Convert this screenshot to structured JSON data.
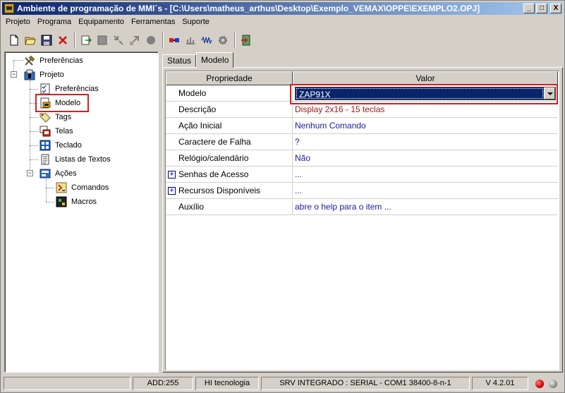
{
  "window": {
    "title": "Ambiente de programação de MMI´s - [C:\\Users\\matheus_arthus\\Desktop\\Exemplo_VEMAX\\OPPE\\EXEMPLO2.OPJ]",
    "minimize_glyph": "_",
    "maximize_glyph": "□",
    "close_glyph": "X"
  },
  "menu": [
    "Projeto",
    "Programa",
    "Equipamento",
    "Ferramentas",
    "Suporte"
  ],
  "toolbar": {
    "icons": [
      "new-file-icon",
      "open-folder-icon",
      "save-icon",
      "delete-x-icon",
      "export-icon",
      "tool2-icon",
      "tool3-icon",
      "tool4-icon",
      "record-icon",
      "connect-icon",
      "transfer-icon",
      "signal-icon",
      "settings-gear-icon",
      "exit-door-icon"
    ]
  },
  "tree": {
    "root_preferences": "Preferências",
    "project": "Projeto",
    "children": [
      "Preferências",
      "Modelo",
      "Tags",
      "Telas",
      "Teclado",
      "Listas de Textos"
    ],
    "actions": "Ações",
    "actions_children": [
      "Comandos",
      "Macros"
    ]
  },
  "tabs": [
    "Status",
    "Modelo"
  ],
  "grid": {
    "header_property": "Propriedade",
    "header_value": "Valor",
    "rows": [
      {
        "property": "Modelo",
        "value": "ZAP91X"
      },
      {
        "property": "Descrição",
        "value": "Display 2x16 - 15 teclas"
      },
      {
        "property": "Ação Inicial",
        "value": "Nenhum Comando"
      },
      {
        "property": "Caractere de Falha",
        "value": "?"
      },
      {
        "property": "Relógio/calendário",
        "value": "Não"
      },
      {
        "property": "Senhas de Acesso",
        "value": "..."
      },
      {
        "property": "Recursos Disponíveis",
        "value": "..."
      },
      {
        "property": "Auxílio",
        "value": "abre o help para o item ..."
      }
    ]
  },
  "statusbar": {
    "addr": "ADD:255",
    "company": "HI tecnologia",
    "connection": "SRV INTEGRADO : SERIAL - COM1 38400-8-n-1",
    "version": "V 4.2.01"
  },
  "colors": {
    "led_red": "#d40000",
    "led_gray": "#909090",
    "highlight": "#d42020",
    "selection": "#0a246a"
  }
}
